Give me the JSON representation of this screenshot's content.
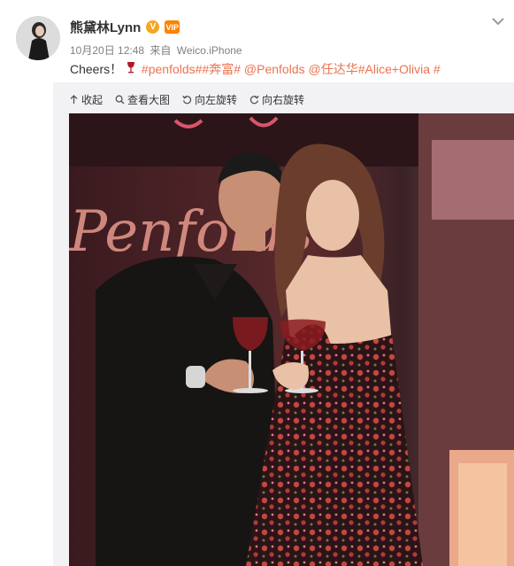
{
  "user": {
    "name": "熊黛林Lynn",
    "verified_badge": "V",
    "member_badge": "VIP"
  },
  "meta": {
    "timestamp": "10月20日 12:48",
    "via_label": "来自",
    "client": "Weico.iPhone"
  },
  "post": {
    "text_before": "Cheers！",
    "wine_icon": "wine-glass-icon",
    "tag1": "#penfolds#",
    "tag2": "#奔富#",
    "mention1": "@Penfolds",
    "mention2": "@任达华",
    "tag3": "#Alice+Olivia #"
  },
  "toolbar": {
    "collapse": "收起",
    "view_large": "查看大图",
    "rotate_left": "向左旋转",
    "rotate_right": "向右旋转"
  },
  "photo": {
    "sign_text": "Penfolds"
  },
  "colors": {
    "link": "#eb7350",
    "panel": "#f2f2f5",
    "badge": "#f5a623"
  }
}
